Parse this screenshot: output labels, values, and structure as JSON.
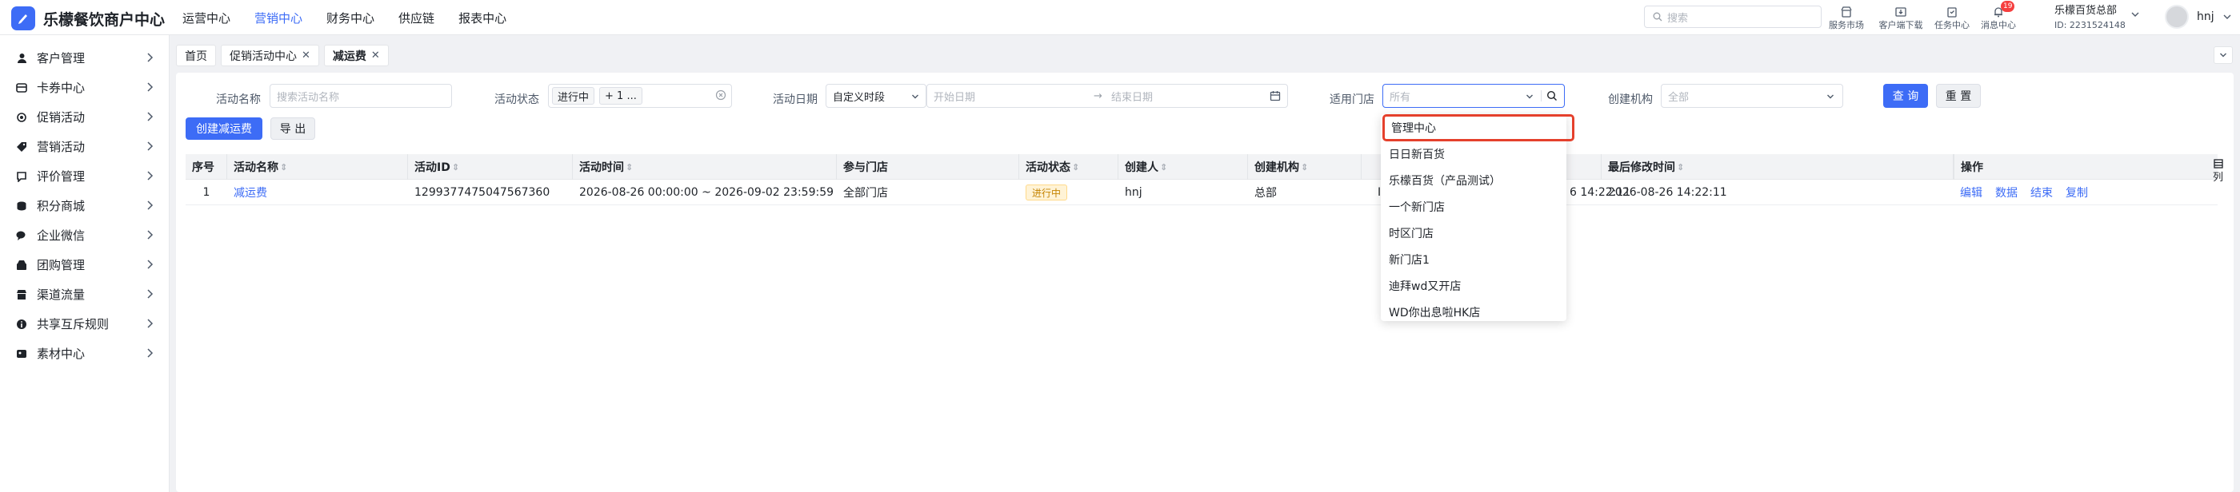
{
  "app": {
    "title": "乐檬餐饮商户中心"
  },
  "top_nav": [
    {
      "label": "运营中心",
      "active": false
    },
    {
      "label": "营销中心",
      "active": true
    },
    {
      "label": "财务中心",
      "active": false
    },
    {
      "label": "供应链",
      "active": false
    },
    {
      "label": "报表中心",
      "active": false
    }
  ],
  "top_search": {
    "placeholder": "搜索"
  },
  "tools": [
    {
      "label": "服务市场",
      "icon": "shop-icon"
    },
    {
      "label": "客户端下载",
      "icon": "download-icon"
    },
    {
      "label": "任务中心",
      "icon": "task-icon"
    },
    {
      "label": "消息中心",
      "icon": "bell-icon",
      "badge": "19"
    }
  ],
  "account": {
    "name": "乐檬百货总部",
    "id": "ID: 2231524148"
  },
  "user": {
    "name": "hnj"
  },
  "sidebar": {
    "items": [
      {
        "label": "客户管理",
        "icon": "user-icon"
      },
      {
        "label": "卡券中心",
        "icon": "card-icon"
      },
      {
        "label": "促销活动",
        "icon": "gear-icon",
        "active": true
      },
      {
        "label": "营销活动",
        "icon": "tag-icon"
      },
      {
        "label": "评价管理",
        "icon": "comment-icon"
      },
      {
        "label": "积分商城",
        "icon": "coins-icon"
      },
      {
        "label": "企业微信",
        "icon": "wechat-icon"
      },
      {
        "label": "团购管理",
        "icon": "group-buy-icon"
      },
      {
        "label": "渠道流量",
        "icon": "store-icon"
      },
      {
        "label": "共享互斥规则",
        "icon": "info-icon"
      },
      {
        "label": "素材中心",
        "icon": "material-icon"
      }
    ]
  },
  "tabs": [
    {
      "label": "首页",
      "closable": false
    },
    {
      "label": "促销活动中心",
      "closable": true
    },
    {
      "label": "减运费",
      "closable": true,
      "active": true
    }
  ],
  "filters": {
    "name": {
      "label": "活动名称",
      "placeholder": "搜索活动名称"
    },
    "status": {
      "label": "活动状态",
      "tags": [
        "进行中",
        "+ 1 ..."
      ]
    },
    "date": {
      "label": "活动日期",
      "mode": "自定义时段",
      "start_placeholder": "开始日期",
      "end_placeholder": "结束日期",
      "separator": "→"
    },
    "store": {
      "label": "适用门店",
      "placeholder": "所有"
    },
    "org": {
      "label": "创建机构",
      "placeholder": "全部"
    },
    "query_label": "查 询",
    "reset_label": "重 置"
  },
  "actions": {
    "create_label": "创建减运费",
    "export_label": "导 出"
  },
  "table": {
    "headers": [
      "序号",
      "活动名称",
      "活动ID",
      "活动时间",
      "参与门店",
      "活动状态",
      "创建人",
      "创建机构",
      "",
      "最后修改时间",
      "操作"
    ],
    "rows": [
      {
        "index": "1",
        "name": "减运费",
        "id": "1299377475047567360",
        "time": "2026-08-26 00:00:00 ~ 2026-09-02 23:59:59",
        "stores": "全部门店",
        "status": "进行中",
        "creator": "hnj",
        "org": "总部",
        "created_partial_mark": "I",
        "created_partial_time": "6 14:22:11",
        "modified": "2026-08-26 14:22:11",
        "ops": [
          "编辑",
          "数据",
          "结束",
          "复制"
        ]
      }
    ],
    "column_settings_label": "列"
  },
  "store_dropdown": {
    "options": [
      "管理中心",
      "日日新百货",
      "乐檬百货（产品测试）",
      "一个新门店",
      "时区门店",
      "新门店1",
      "迪拜wd又开店",
      "WD你出息啦HK店"
    ],
    "highlighted_index": 0
  },
  "colors": {
    "primary": "#3d6cf6",
    "highlight_border": "#e5402c",
    "status_bg": "#fff3d6",
    "status_text": "#c58300"
  }
}
